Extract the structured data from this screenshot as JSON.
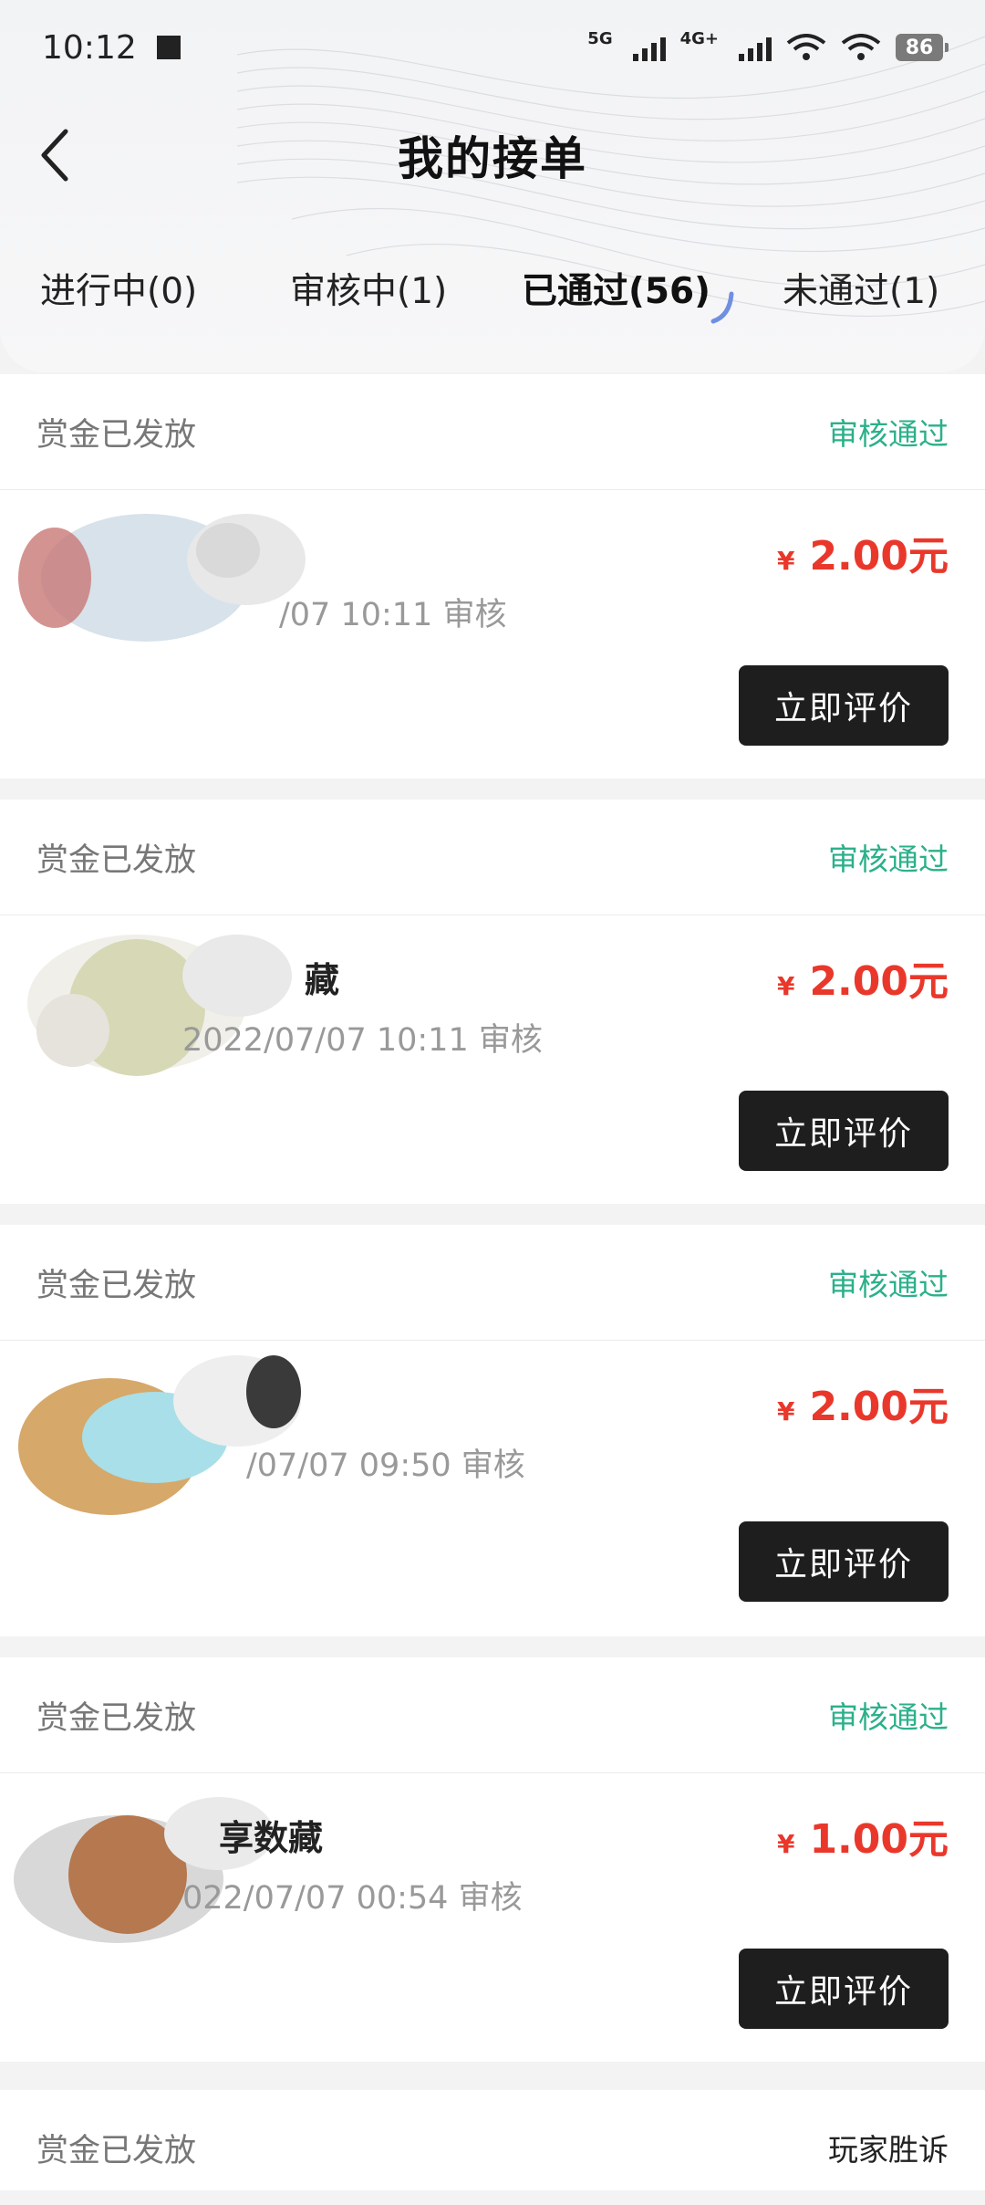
{
  "status_bar": {
    "time": "10:12",
    "network_1": "5G",
    "network_2": "4G+",
    "battery": "86"
  },
  "navbar": {
    "title": "我的接单"
  },
  "tabs": [
    {
      "label": "进行中(0)",
      "active": false
    },
    {
      "label": "审核中(1)",
      "active": false
    },
    {
      "label": "已通过(56)",
      "active": true
    },
    {
      "label": "未通过(1)",
      "active": false
    }
  ],
  "orders": [
    {
      "payout_status": "赏金已发放",
      "review_status": "审核通过",
      "name": "",
      "time": "/07 10:11 审核",
      "currency": "¥",
      "amount": "2.00元",
      "action": "立即评价"
    },
    {
      "payout_status": "赏金已发放",
      "review_status": "审核通过",
      "name": "藏",
      "time": "2022/07/07 10:11 审核",
      "currency": "¥",
      "amount": "2.00元",
      "action": "立即评价"
    },
    {
      "payout_status": "赏金已发放",
      "review_status": "审核通过",
      "name": "",
      "time": "/07/07 09:50 审核",
      "currency": "¥",
      "amount": "2.00元",
      "action": "立即评价"
    },
    {
      "payout_status": "赏金已发放",
      "review_status": "审核通过",
      "name": "享数藏",
      "time": "022/07/07 00:54 审核",
      "currency": "¥",
      "amount": "1.00元",
      "action": "立即评价"
    },
    {
      "payout_status": "赏金已发放",
      "review_status": "玩家胜诉"
    }
  ],
  "colors": {
    "approved": "#2bb08a",
    "price": "#e9382b",
    "button": "#1e1e1e"
  }
}
